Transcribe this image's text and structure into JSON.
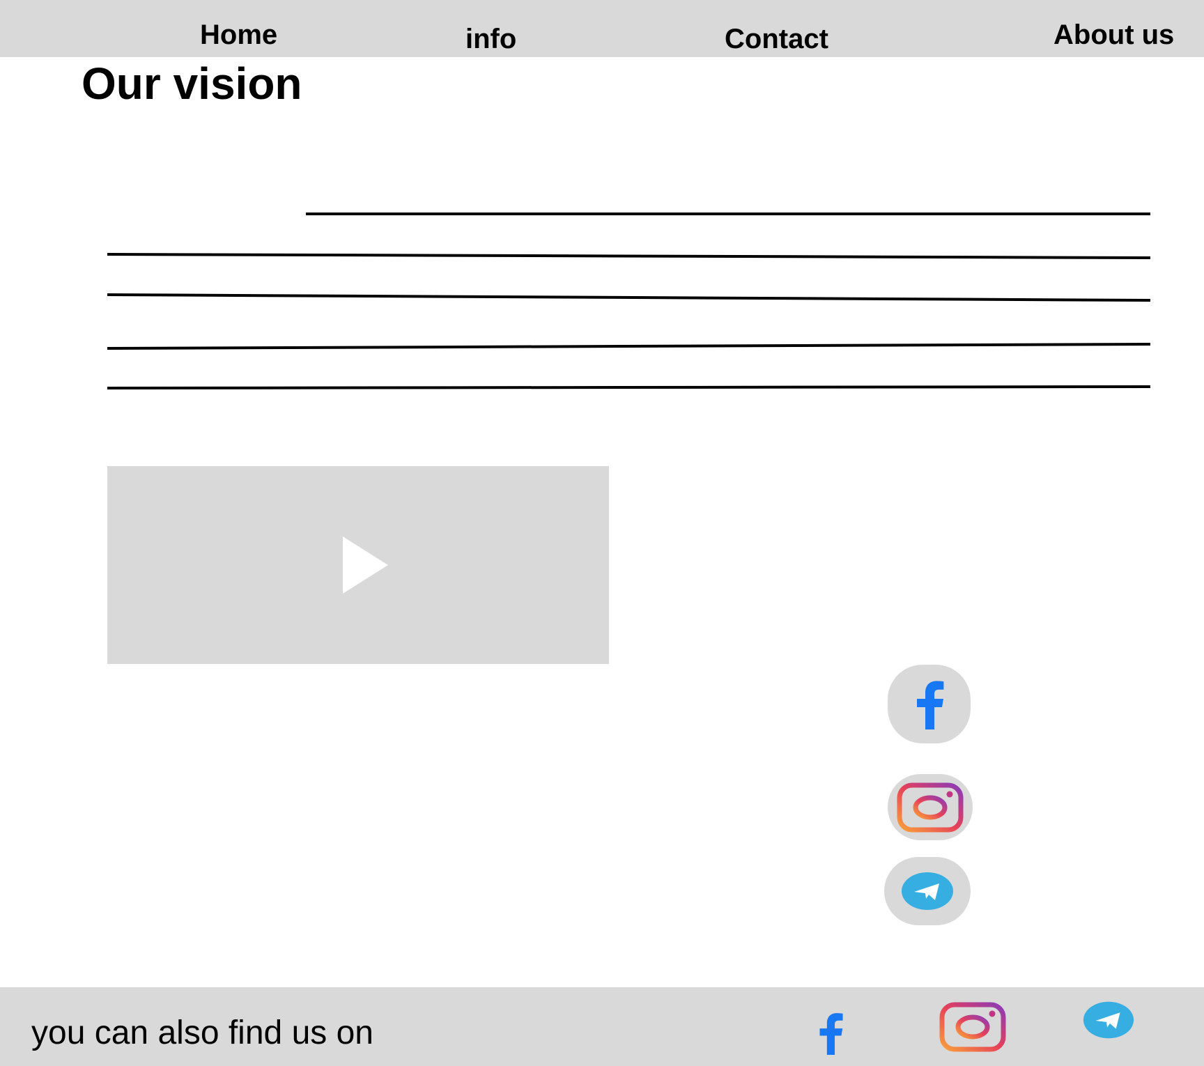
{
  "nav": {
    "home": "Home",
    "info": "info",
    "contact": "Contact",
    "about": "About us"
  },
  "main": {
    "title": "Our vision"
  },
  "social": {
    "icons": [
      "facebook-icon",
      "instagram-icon",
      "telegram-icon"
    ]
  },
  "footer": {
    "text": "you can also find us on",
    "icons": [
      "facebook-icon",
      "instagram-icon",
      "telegram-icon"
    ]
  },
  "colors": {
    "bar_gray": "#d9d9d9",
    "facebook_blue": "#1877f2",
    "telegram_blue": "#37aee2"
  }
}
